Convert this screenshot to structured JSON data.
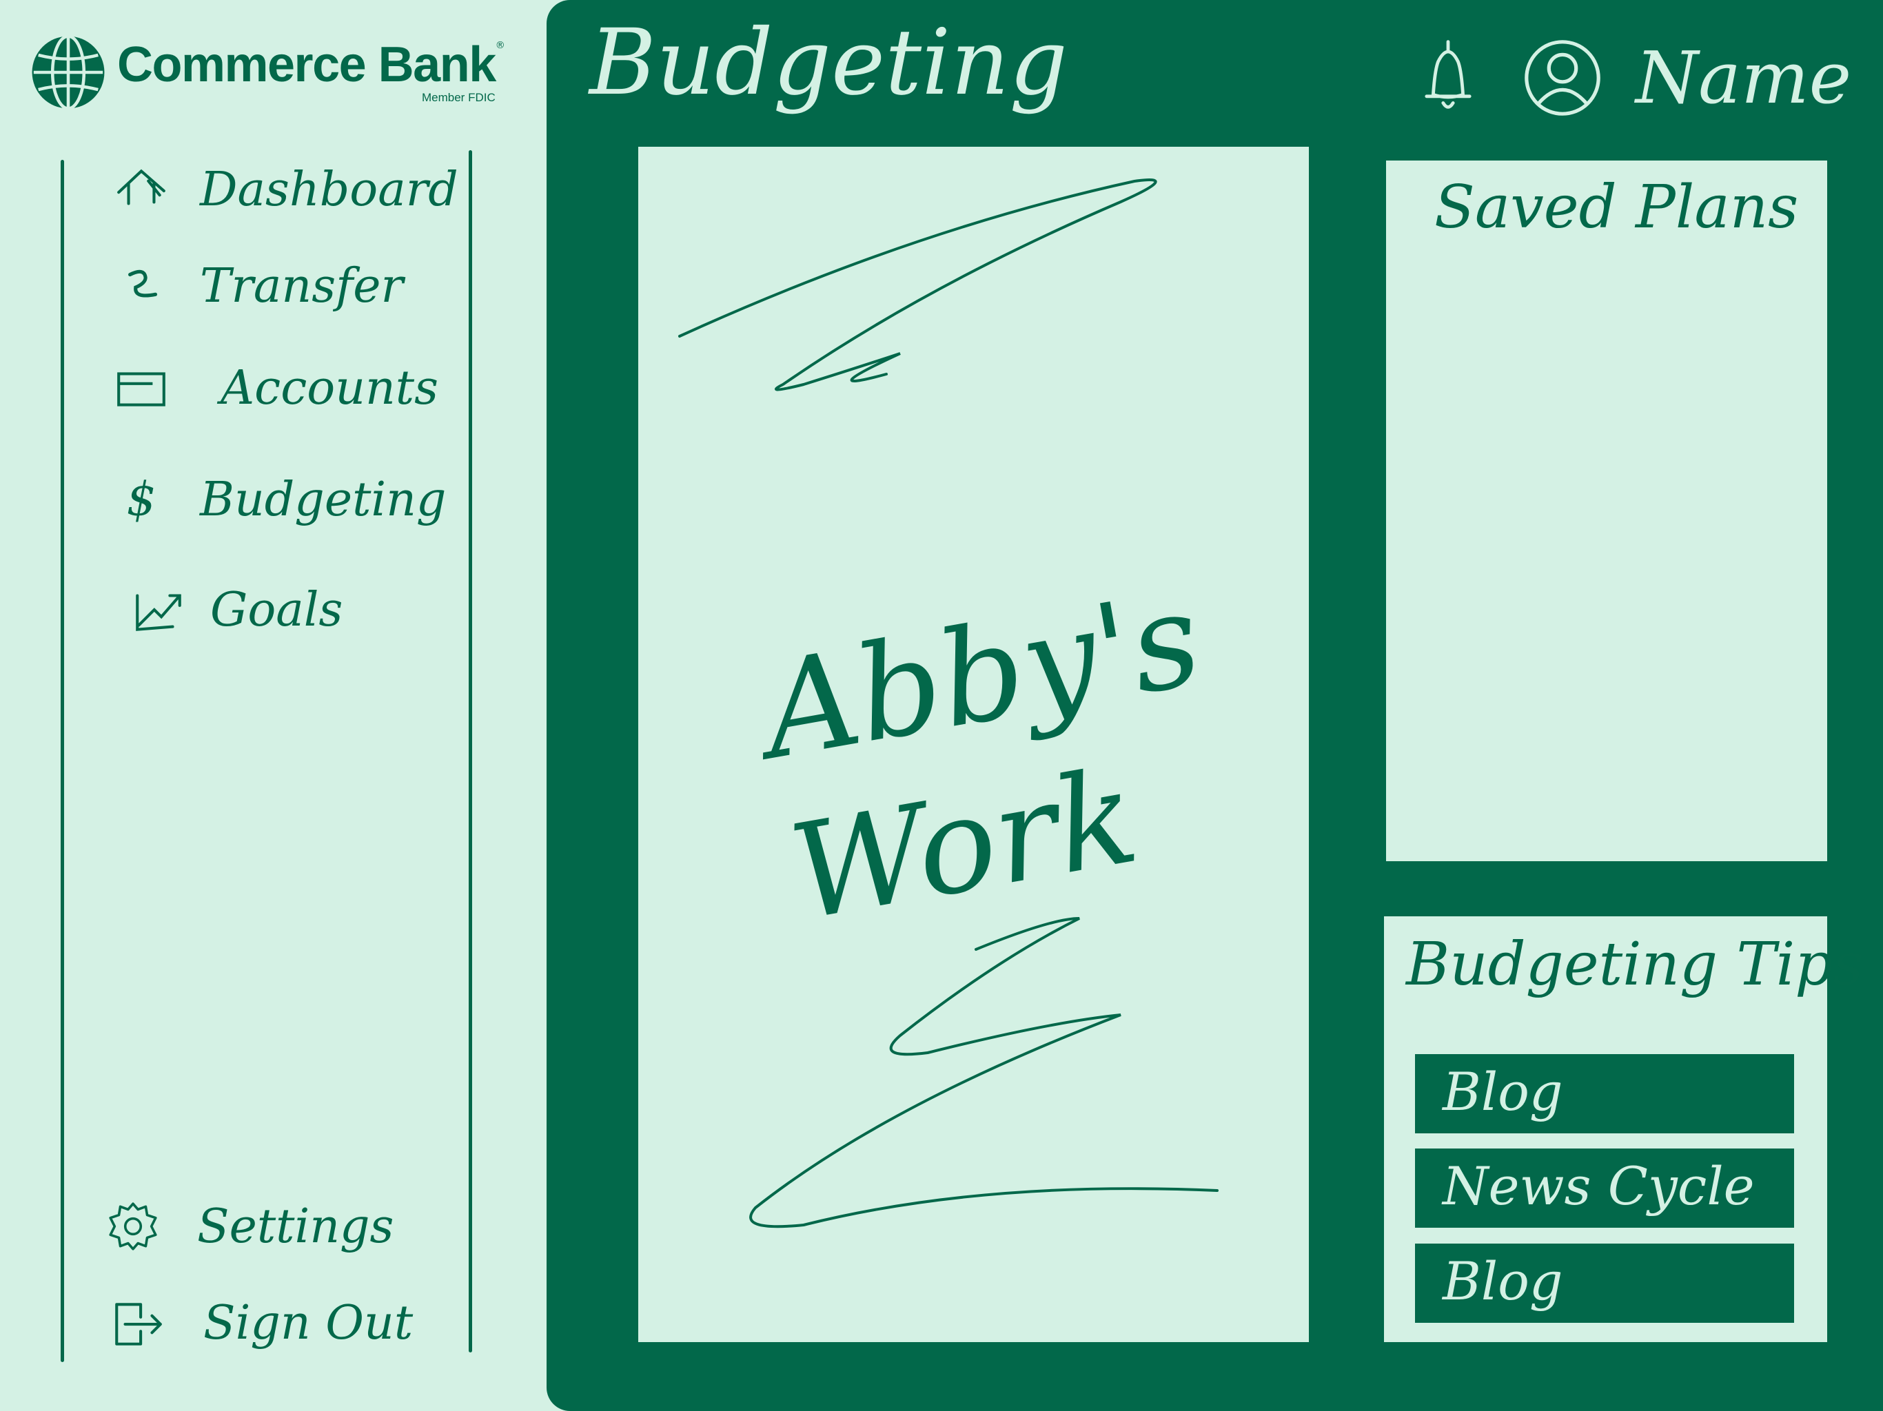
{
  "brand": {
    "name": "Commerce Bank",
    "registered": "®",
    "fdic": "Member FDIC"
  },
  "sidebar": {
    "items": [
      {
        "label": "Dashboard",
        "icon": "home-icon"
      },
      {
        "label": "Transfer",
        "icon": "transfer-icon"
      },
      {
        "label": "Accounts",
        "icon": "card-icon"
      },
      {
        "label": "Budgeting",
        "icon": "dollar-icon"
      },
      {
        "label": "Goals",
        "icon": "trend-up-icon"
      }
    ],
    "bottom_items": [
      {
        "label": "Settings",
        "icon": "gear-icon"
      },
      {
        "label": "Sign Out",
        "icon": "sign-out-icon"
      }
    ]
  },
  "header": {
    "title": "Budgeting",
    "user_name": "Name",
    "icons": [
      "bell-icon",
      "user-avatar-icon"
    ]
  },
  "workspace": {
    "text": "Abby's Work"
  },
  "saved_plans": {
    "title": "Saved Plans"
  },
  "tips": {
    "title": "Budgeting Tips",
    "items": [
      "Blog",
      "News Cycle",
      "Blog"
    ]
  },
  "colors": {
    "dark_green": "#02684a",
    "mint": "#d4f1e4"
  }
}
